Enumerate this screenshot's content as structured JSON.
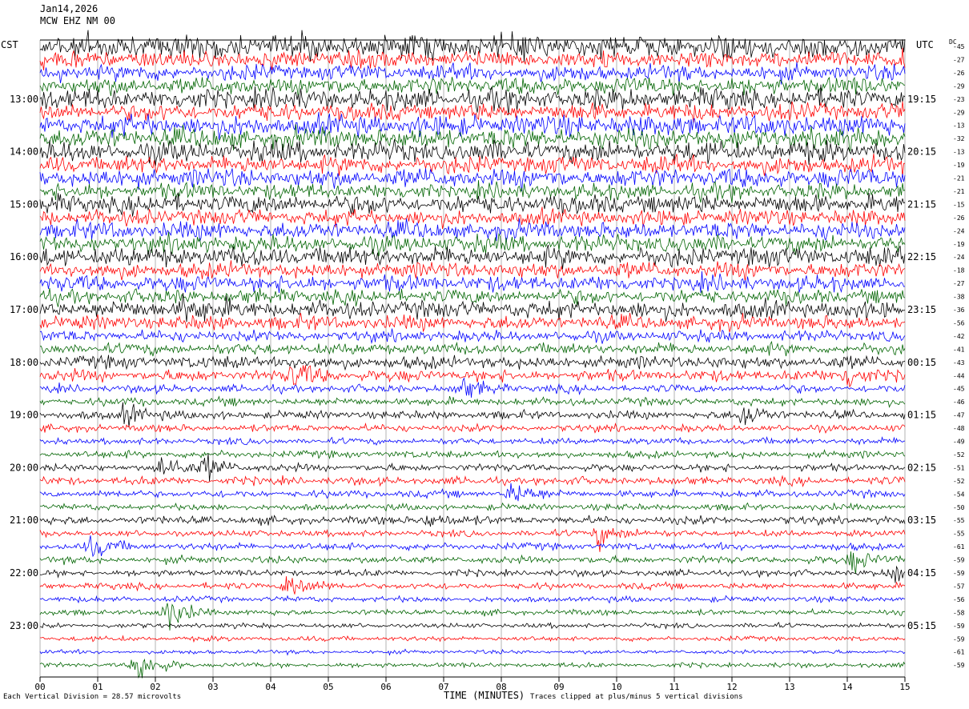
{
  "header": {
    "date": "Jan14,2026",
    "station": "MCW EHZ NM 00"
  },
  "timezones": {
    "left": "CST",
    "right": "UTC",
    "offset_label": "DC"
  },
  "chart_data": {
    "type": "seismogram",
    "xlabel": "TIME (MINUTES)",
    "x_ticks": [
      "00",
      "01",
      "02",
      "03",
      "04",
      "05",
      "06",
      "07",
      "08",
      "09",
      "10",
      "11",
      "12",
      "13",
      "14",
      "15"
    ],
    "xlim": [
      0,
      15
    ],
    "left_hour_labels": [
      "13:00",
      "14:00",
      "15:00",
      "16:00",
      "17:00",
      "18:00",
      "19:00",
      "20:00",
      "21:00",
      "22:00",
      "23:00"
    ],
    "right_hour_labels": [
      "19:15",
      "20:15",
      "21:15",
      "22:15",
      "23:15",
      "00:15",
      "01:15",
      "02:15",
      "03:15",
      "04:15",
      "05:15"
    ],
    "dc_offsets": [
      "-45",
      "-27",
      "-26",
      "-29",
      "-23",
      "-29",
      "-13",
      "-32",
      "-13",
      "-19",
      "-21",
      "-21",
      "-15",
      "-26",
      "-24",
      "-19",
      "-24",
      "-18",
      "-27",
      "-38",
      "-36",
      "-56",
      "-42",
      "-41",
      "-43",
      "-44",
      "-45",
      "-46",
      "-47",
      "-48",
      "-49",
      "-52",
      "-51",
      "-52",
      "-54",
      "-50",
      "-55",
      "-55",
      "-61",
      "-59",
      "-59",
      "-57",
      "-56",
      "-58",
      "-59",
      "-59",
      "-61",
      "-59"
    ],
    "trace_colors": [
      "#000000",
      "#ff0000",
      "#0000ff",
      "#006400"
    ],
    "trace_amplitudes": [
      30,
      22,
      20,
      22,
      26,
      22,
      26,
      26,
      26,
      22,
      24,
      20,
      24,
      20,
      22,
      22,
      24,
      20,
      20,
      18,
      22,
      18,
      14,
      14,
      16,
      14,
      10,
      10,
      10,
      9,
      8,
      9,
      9,
      10,
      9,
      8,
      10,
      8,
      9,
      9,
      8,
      8,
      7,
      7,
      6,
      6,
      5,
      6
    ],
    "bursts": [
      {
        "trace": 20,
        "minute": 2.5,
        "amp": 30
      },
      {
        "trace": 25,
        "minute": 4.4,
        "amp": 30
      },
      {
        "trace": 26,
        "minute": 7.3,
        "amp": 25
      },
      {
        "trace": 25,
        "minute": 14.0,
        "amp": 30
      },
      {
        "trace": 28,
        "minute": 1.5,
        "amp": 26
      },
      {
        "trace": 28,
        "minute": 12.2,
        "amp": 30
      },
      {
        "trace": 32,
        "minute": 2.1,
        "amp": 30
      },
      {
        "trace": 32,
        "minute": 2.9,
        "amp": 26
      },
      {
        "trace": 34,
        "minute": 8.2,
        "amp": 26
      },
      {
        "trace": 37,
        "minute": 9.7,
        "amp": 30
      },
      {
        "trace": 36,
        "minute": 6.7,
        "amp": 18
      },
      {
        "trace": 38,
        "minute": 0.9,
        "amp": 22
      },
      {
        "trace": 39,
        "minute": 14.1,
        "amp": 28
      },
      {
        "trace": 41,
        "minute": 4.3,
        "amp": 34
      },
      {
        "trace": 40,
        "minute": 14.8,
        "amp": 28
      },
      {
        "trace": 43,
        "minute": 2.2,
        "amp": 40
      },
      {
        "trace": 47,
        "minute": 1.7,
        "amp": 40
      }
    ]
  },
  "footer": {
    "scale_note": "Each Vertical Division =   28.57 microvolts",
    "clip_note": "Traces clipped at plus/minus 5 vertical divisions"
  }
}
